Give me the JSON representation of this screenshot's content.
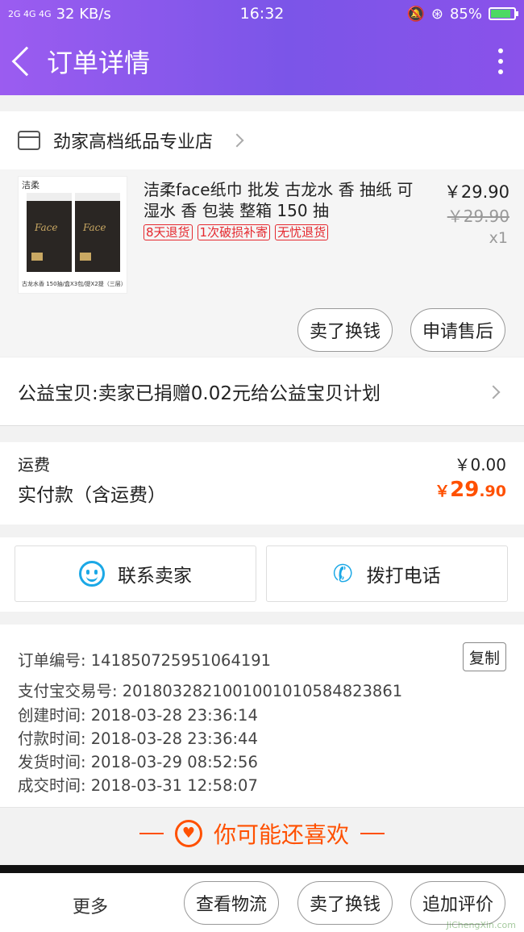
{
  "status_bar": {
    "signal": "2G 4G 4G",
    "speed": "32 KB/s",
    "time": "16:32",
    "battery": "85%",
    "battery_level": 0.85
  },
  "header": {
    "title": "订单详情"
  },
  "shop": {
    "name": "劲家高档纸品专业店"
  },
  "product": {
    "brand_logo": "洁柔",
    "image_caption": "古龙水香 150抽/盒X3包/提X2提（三层）",
    "pack_text": "Face",
    "title": "洁柔face纸巾 批发 古龙水 香 抽纸 可湿水 香 包装 整箱 150 抽",
    "tags": [
      "8天退货",
      "1次破损补寄",
      "无忧退货"
    ],
    "price": "￥29.90",
    "original_price": "￥29.90",
    "quantity": "x1",
    "btn_sell": "卖了换钱",
    "btn_after_sale": "申请售后"
  },
  "charity": {
    "text": "公益宝贝:卖家已捐赠0.02元给公益宝贝计划"
  },
  "fees": {
    "shipping_label": "运费",
    "shipping_value": "￥0.00",
    "total_label": "实付款（含运费）",
    "total_symbol": "￥",
    "total_int": "29",
    "total_dec": ".90"
  },
  "contacts": {
    "seller": "联系卖家",
    "phone": "拨打电话"
  },
  "order_info": {
    "order_no": "订单编号: 141850725951064191",
    "alipay_no": "支付宝交易号: 2018032821001001010584823861",
    "created": "创建时间: 2018-03-28 23:36:14",
    "paid": "付款时间: 2018-03-28 23:36:44",
    "shipped": "发货时间: 2018-03-29 08:52:56",
    "completed": "成交时间: 2018-03-31 12:58:07",
    "copy_label": "复制"
  },
  "recommend": {
    "title": "你可能还喜欢"
  },
  "bottom_bar": {
    "more": "更多",
    "logistics": "查看物流",
    "sell": "卖了换钱",
    "review": "追加评价"
  },
  "watermark": {
    "text": "JiChengXin.com"
  },
  "colors": {
    "header_start": "#9b5cf0",
    "header_end": "#7b55e8",
    "price_accent": "#ff5000",
    "tag_red": "#e5292f",
    "icon_blue": "#1ba8e6"
  }
}
